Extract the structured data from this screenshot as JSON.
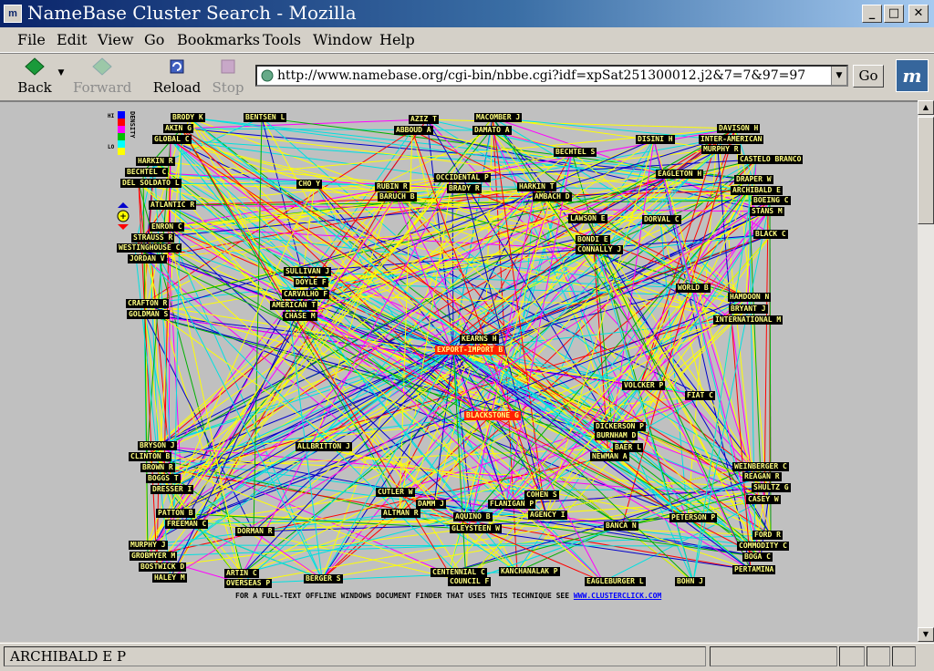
{
  "window": {
    "title": "NameBase Cluster Search - Mozilla",
    "app_icon": "mozilla-icon",
    "controls": [
      "minimize-icon",
      "maximize-icon",
      "close-icon"
    ]
  },
  "menu": [
    "File",
    "Edit",
    "View",
    "Go",
    "Bookmarks",
    "Tools",
    "Window",
    "Help"
  ],
  "toolbar": {
    "back": "Back",
    "forward": "Forward",
    "reload": "Reload",
    "stop": "Stop",
    "url": "http://www.namebase.org/cgi-bin/nbbe.cgi?idf=xpSat251300012.j2&7=7&97=97",
    "go": "Go"
  },
  "legend": {
    "hi": "HI",
    "lo": "LO",
    "label": "DENSITY",
    "colors": [
      "#0000ff",
      "#ff0000",
      "#ff00ff",
      "#00c000",
      "#00ffff",
      "#ffff00"
    ]
  },
  "colors": {
    "edge_yellow": "#ffff00",
    "edge_cyan": "#00e0e0",
    "edge_blue": "#0000cc",
    "edge_red": "#ff0000",
    "edge_green": "#00b000",
    "edge_magenta": "#ff00ff",
    "label_bg": "#000000",
    "label_fg": "#ffff80",
    "hot_bg": "#ff2000"
  },
  "nodes": [
    {
      "label": "BRODY K"
    },
    {
      "label": "AKIN G"
    },
    {
      "label": "GLOBAL C"
    },
    {
      "label": "BENTSEN L"
    },
    {
      "label": "AZIZ T"
    },
    {
      "label": "ABBOUD A"
    },
    {
      "label": "MACOMBER J"
    },
    {
      "label": "DAMATO A"
    },
    {
      "label": "DAVISON H"
    },
    {
      "label": "INTER-AMERICAN"
    },
    {
      "label": "DISINI H"
    },
    {
      "label": "MURPHY R"
    },
    {
      "label": "CASTELO BRANCO"
    },
    {
      "label": "BECHTEL S"
    },
    {
      "label": "HARKIN R"
    },
    {
      "label": "BECHTEL C"
    },
    {
      "label": "DEL SOLDATO L"
    },
    {
      "label": "CHO Y"
    },
    {
      "label": "OCCIDENTAL P"
    },
    {
      "label": "RUBIN R"
    },
    {
      "label": "BRADY R"
    },
    {
      "label": "HARKIN T"
    },
    {
      "label": "EAGLETON H"
    },
    {
      "label": "DRAPER W"
    },
    {
      "label": "ARCHIBALD E"
    },
    {
      "label": "BOEING C"
    },
    {
      "label": "STANS M"
    },
    {
      "label": "BARUCH B"
    },
    {
      "label": "AMBACH D"
    },
    {
      "label": "ATLANTIC R"
    },
    {
      "label": "LAWSON E"
    },
    {
      "label": "DORVAL C"
    },
    {
      "label": "ENRON C"
    },
    {
      "label": "BLACK C"
    },
    {
      "label": "STRAUSS R"
    },
    {
      "label": "BONDI E"
    },
    {
      "label": "WESTINGHOUSE C"
    },
    {
      "label": "CONNALLY J"
    },
    {
      "label": "JORDAN V"
    },
    {
      "label": "SULLIVAN J"
    },
    {
      "label": "DOYLE F"
    },
    {
      "label": "CARVALHO F"
    },
    {
      "label": "WORLD B"
    },
    {
      "label": "CRAFTON R"
    },
    {
      "label": "AMERICAN T"
    },
    {
      "label": "HAMDOON N"
    },
    {
      "label": "GOLDMAN S"
    },
    {
      "label": "CHASE M"
    },
    {
      "label": "BRYANT J"
    },
    {
      "label": "INTERNATIONAL M"
    },
    {
      "label": "KEARNS H"
    },
    {
      "label": "EXPORT-IMPORT B"
    },
    {
      "label": "VOLCKER P"
    },
    {
      "label": "FIAT C"
    },
    {
      "label": "BLACKSTONE G"
    },
    {
      "label": "DICKERSON P"
    },
    {
      "label": "BURNHAM D"
    },
    {
      "label": "BRYSON J"
    },
    {
      "label": "ALLBRITTON J"
    },
    {
      "label": "BAER L"
    },
    {
      "label": "CLINTON B"
    },
    {
      "label": "NEWMAN A"
    },
    {
      "label": "BROWN R"
    },
    {
      "label": "WEINBERGER C"
    },
    {
      "label": "BOGGS T"
    },
    {
      "label": "REAGAN R"
    },
    {
      "label": "DRESSER I"
    },
    {
      "label": "SHULTZ G"
    },
    {
      "label": "CUTLER W"
    },
    {
      "label": "COHEN S"
    },
    {
      "label": "CASEY W"
    },
    {
      "label": "DAMM J"
    },
    {
      "label": "FLANIGAN P"
    },
    {
      "label": "PATTON B"
    },
    {
      "label": "ALTMAN R"
    },
    {
      "label": "AQUINO B"
    },
    {
      "label": "AGENCY I"
    },
    {
      "label": "PETERSON P"
    },
    {
      "label": "FREEMAN C"
    },
    {
      "label": "BANCA N"
    },
    {
      "label": "DORMAN R"
    },
    {
      "label": "GLEYSTEEN W"
    },
    {
      "label": "FORD R"
    },
    {
      "label": "MURPHY J"
    },
    {
      "label": "COMMODITY C"
    },
    {
      "label": "GROBMYER M"
    },
    {
      "label": "BOGA C"
    },
    {
      "label": "BOSTWICK D"
    },
    {
      "label": "ARTIN C"
    },
    {
      "label": "CENTENNIAL C"
    },
    {
      "label": "KANCHANALAK P"
    },
    {
      "label": "PERTAMINA"
    },
    {
      "label": "HALEY M"
    },
    {
      "label": "OVERSEAS P"
    },
    {
      "label": "BERGER S"
    },
    {
      "label": "COUNCIL F"
    },
    {
      "label": "EAGLEBURGER L"
    },
    {
      "label": "BOHN J"
    }
  ],
  "footer": {
    "text": "FOR A FULL-TEXT OFFLINE WINDOWS DOCUMENT FINDER THAT USES THIS TECHNIQUE SEE",
    "link": "WWW.CLUSTERCLICK.COM"
  },
  "status": {
    "text": "ARCHIBALD E P"
  }
}
